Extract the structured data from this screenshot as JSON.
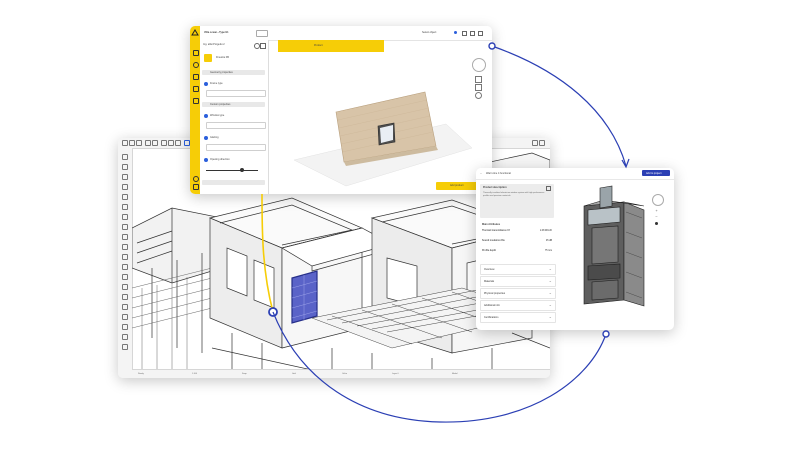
{
  "app_window": {
    "tab_name": "Villa ocean...Type E1",
    "project_name": "Ing. alfai Progetto 2",
    "active_tab": "Product",
    "object_label": "Finestra FB",
    "sections": [
      "Geometry properties",
      "Custom properties"
    ],
    "fields": [
      "Frame type",
      "Window type",
      "Glazing",
      "Opening direction"
    ],
    "cta_label": "Add product",
    "top_right_label": "Select object"
  },
  "product_window": {
    "title": "Warm-line 4 functional",
    "button_label": "Add to project",
    "section_title": "Product description",
    "description": "Thermally insulated aluminium window system with high performance profiles and premium materials.",
    "properties_title": "Main Attributes",
    "properties": [
      {
        "label": "Thermal transmittance Uf",
        "value": "1.08 W/m²K"
      },
      {
        "label": "Sound insulation Rw",
        "value": "45 dB"
      },
      {
        "label": "Profile depth",
        "value": "75 mm"
      }
    ],
    "accordions": [
      "Overview",
      "Materials",
      "Physical properties",
      "Additional info",
      "Certifications"
    ]
  },
  "cad_window": {
    "status_items": [
      "Ready",
      "1:100",
      "Snap",
      "Grid",
      "Ortho",
      "Layer 0",
      "Model"
    ]
  },
  "colors": {
    "accent_yellow": "#f6cd07",
    "accent_blue": "#2b3fb4",
    "window_highlight": "#5a63c8"
  }
}
